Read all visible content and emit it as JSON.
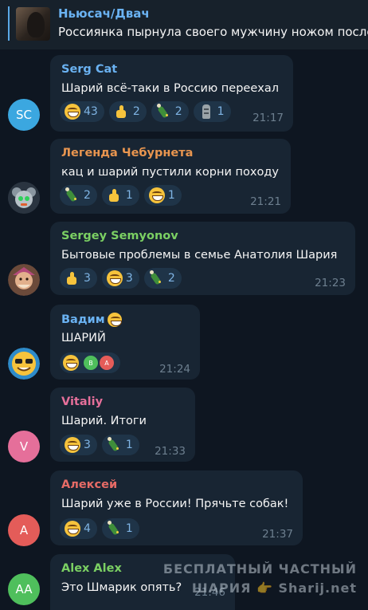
{
  "pinned": {
    "title": "Ньюсач/Двач",
    "text": "Россиянка пырнула своего мужчину ножом после"
  },
  "messages": [
    {
      "author": "Serg Cat",
      "author_color": "#6ab2f2",
      "avatar_initials": "SC",
      "avatar_color": "#3ba7e0",
      "text": "Шарий всё-таки в Россию переехал",
      "reactions": [
        {
          "emoji": "grinning-icon",
          "count": "43"
        },
        {
          "emoji": "thumbs-up-icon",
          "count": "2"
        },
        {
          "emoji": "champagne-icon",
          "count": "2"
        },
        {
          "emoji": "moai-icon",
          "count": "1"
        }
      ],
      "time": "21:17"
    },
    {
      "author": "Легенда Чебурнета",
      "author_color": "#e8954f",
      "avatar_initials": "",
      "text": "кац и шарий пустили корни походу",
      "reactions": [
        {
          "emoji": "champagne-icon",
          "count": "2"
        },
        {
          "emoji": "thumbs-up-icon",
          "count": "1"
        },
        {
          "emoji": "grinning-icon",
          "count": "1"
        }
      ],
      "time": "21:21"
    },
    {
      "author": "Sergey Semyonov",
      "author_color": "#7bd063",
      "avatar_initials": "",
      "text": "Бытовые проблемы в семье Анатолия Шария",
      "reactions": [
        {
          "emoji": "thumbs-up-icon",
          "count": "3"
        },
        {
          "emoji": "grinning-icon",
          "count": "3"
        },
        {
          "emoji": "champagne-icon",
          "count": "2"
        }
      ],
      "time": "21:23"
    },
    {
      "author": "Вадим",
      "author_color": "#6ab2f2",
      "avatar_initials": "",
      "text": "ШАРИЙ",
      "mini_avatars": [
        "В",
        "A"
      ],
      "time": "21:24"
    },
    {
      "author": "Vitaliy",
      "author_color": "#e56f9a",
      "avatar_initials": "V",
      "avatar_color": "#e56f9a",
      "text": "Шарий. Итоги",
      "reactions": [
        {
          "emoji": "grinning-icon",
          "count": "3"
        },
        {
          "emoji": "champagne-icon",
          "count": "1"
        }
      ],
      "time": "21:33"
    },
    {
      "author": "Алексей",
      "author_color": "#e66b66",
      "avatar_initials": "A",
      "avatar_color": "#e45c59",
      "text": "Шарий уже в России! Прячьте собак!",
      "reactions": [
        {
          "emoji": "grinning-icon",
          "count": "4"
        },
        {
          "emoji": "champagne-icon",
          "count": "1"
        }
      ],
      "time": "21:37"
    },
    {
      "author": "Alex Alex",
      "author_color": "#7bd063",
      "avatar_initials": "AA",
      "avatar_color": "#4fbf5c",
      "text": "Это Шмарик опять?",
      "time": "21:46"
    }
  ],
  "watermark": {
    "line1": "БЕСПЛАТНЫЙ ЧАСТНЫЙ",
    "line2": "ШАРИЯ 👉 Sharij.net"
  }
}
